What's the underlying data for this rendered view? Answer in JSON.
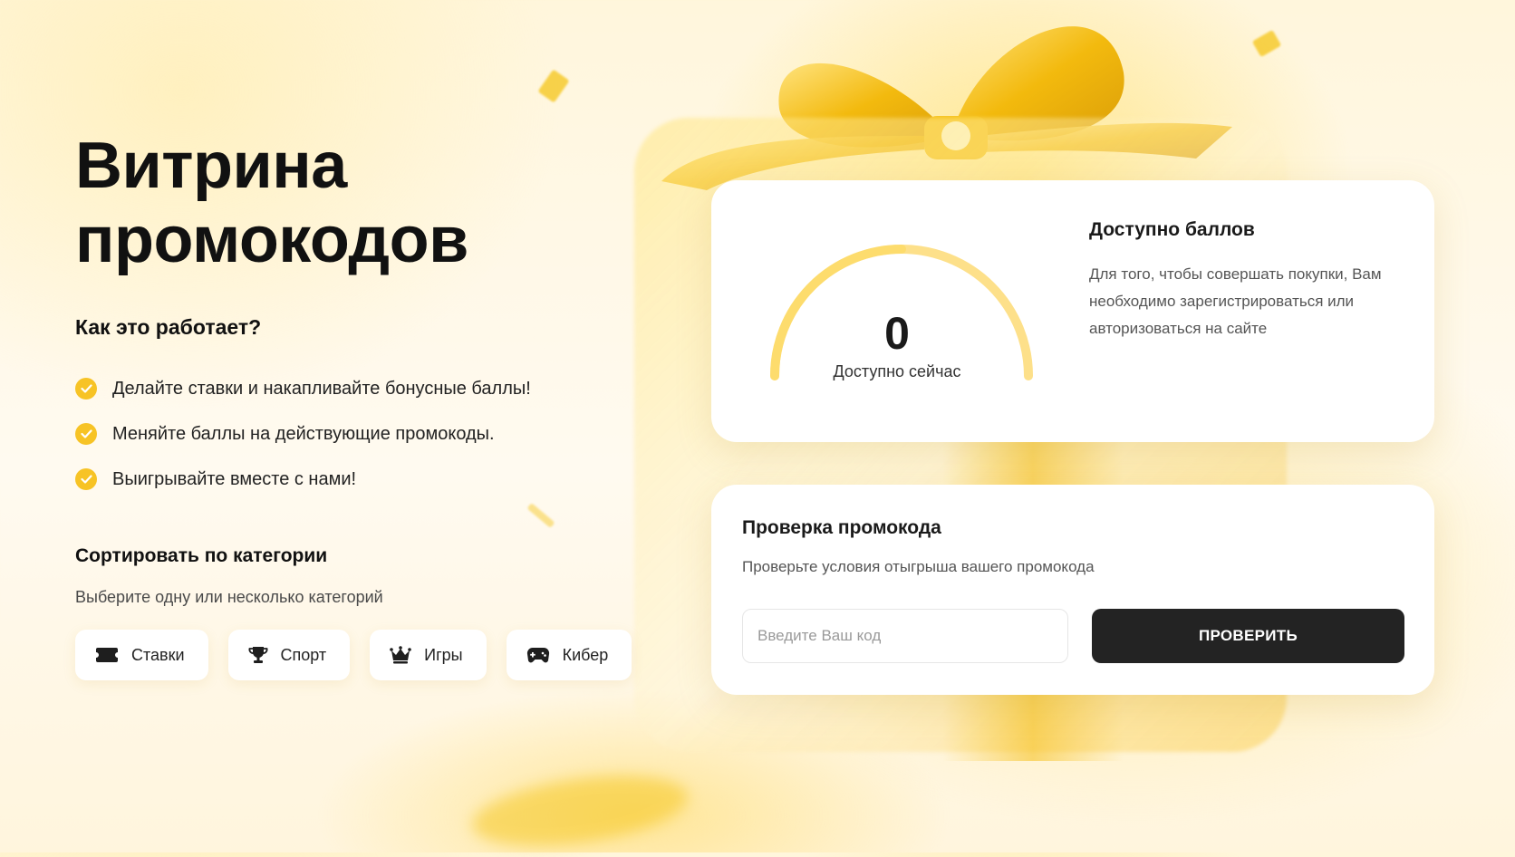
{
  "hero": {
    "title_line1": "Витрина",
    "title_line2": "промокодов"
  },
  "how_it_works": {
    "title": "Как это работает?",
    "steps": [
      "Делайте ставки и накапливайте бонусные баллы!",
      "Меняйте баллы на действующие промокоды.",
      "Выигрывайте вместе с нами!"
    ]
  },
  "sort": {
    "title": "Сортировать по категории",
    "subtitle": "Выберите одну или несколько категорий",
    "categories": [
      {
        "label": "Ставки",
        "icon": "ticket-icon"
      },
      {
        "label": "Спорт",
        "icon": "trophy-icon"
      },
      {
        "label": "Игры",
        "icon": "crown-icon"
      },
      {
        "label": "Кибер",
        "icon": "gamepad-icon"
      }
    ]
  },
  "points": {
    "value": "0",
    "value_label": "Доступно сейчас",
    "title": "Доступно баллов",
    "description": "Для того, чтобы совершать покупки, Вам необходимо зарегистрироваться или авторизоваться на сайте"
  },
  "promo": {
    "title": "Проверка промокода",
    "subtitle": "Проверьте условия отыгрыша вашего промокода",
    "input_placeholder": "Введите Ваш код",
    "input_value": "",
    "button_label": "ПРОВЕРИТЬ"
  },
  "colors": {
    "accent": "#f7c325",
    "button_dark": "#232323",
    "gauge": "#fdd85a"
  }
}
